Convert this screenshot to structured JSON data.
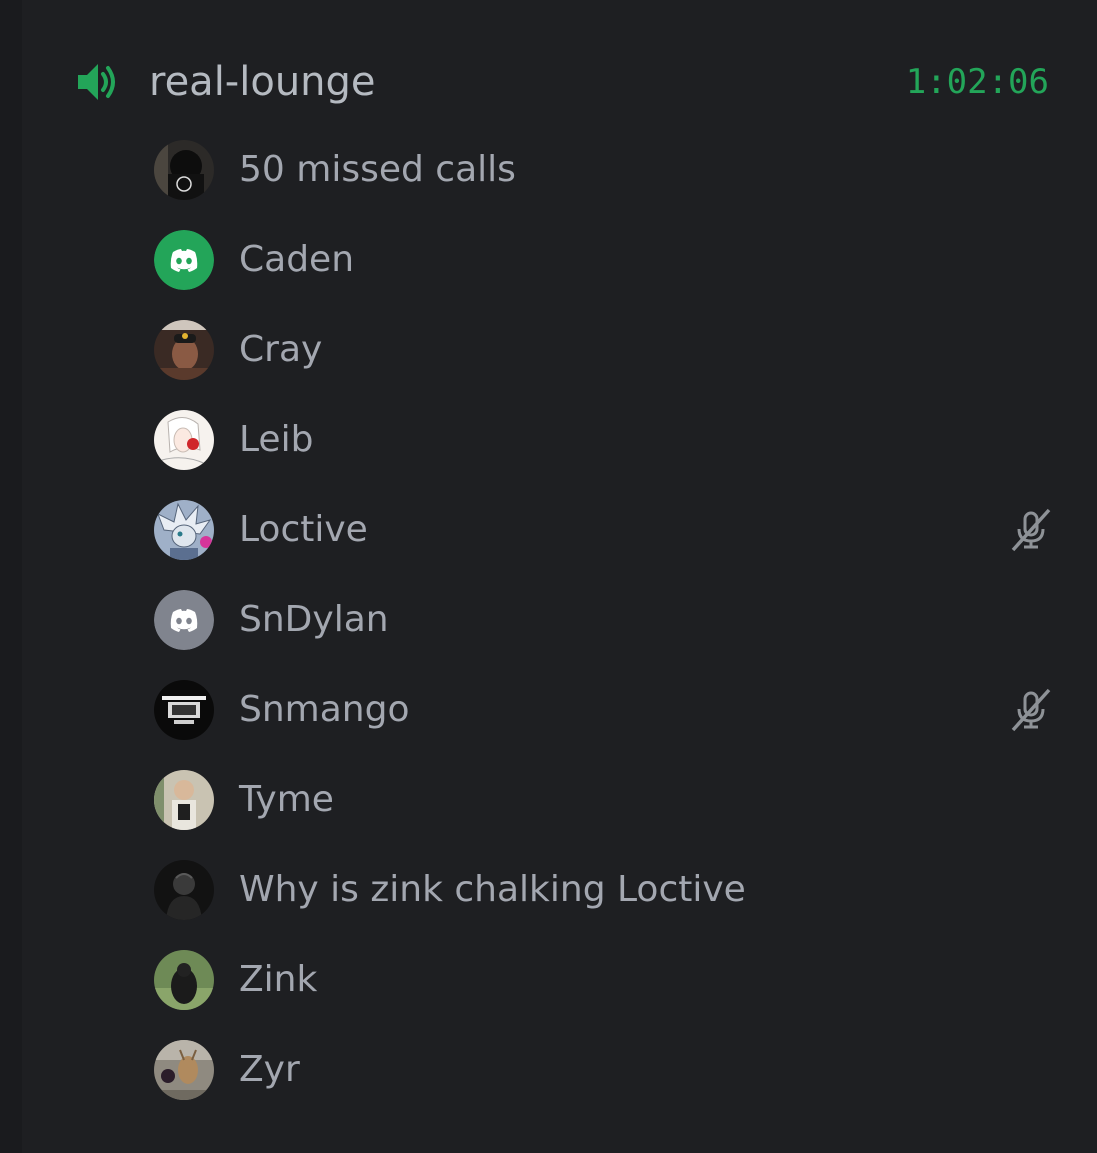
{
  "voice_channel": {
    "name": "real-lounge",
    "icon": "speaker-icon",
    "duration": "1:02:06",
    "accent_color": "#23a559"
  },
  "members": [
    {
      "name": "50 missed calls",
      "avatar": "photo-hooded-figure",
      "muted": false
    },
    {
      "name": "Caden",
      "avatar": "discord-logo-green",
      "muted": false
    },
    {
      "name": "Cray",
      "avatar": "photo-person-cap",
      "muted": false
    },
    {
      "name": "Leib",
      "avatar": "drawing-anime-girl",
      "muted": false
    },
    {
      "name": "Loctive",
      "avatar": "drawing-silver-hedgehog",
      "muted": true,
      "muted_icon": "microphone-muted-icon"
    },
    {
      "name": "SnDylan",
      "avatar": "discord-logo-gray",
      "muted": false
    },
    {
      "name": "Snmango",
      "avatar": "photo-dark-sign",
      "muted": true,
      "muted_icon": "microphone-muted-icon"
    },
    {
      "name": "Tyme",
      "avatar": "photo-mirror-selfie",
      "muted": false
    },
    {
      "name": "Why is zink chalking Loctive",
      "avatar": "photo-dark-figure",
      "muted": false
    },
    {
      "name": "Zink",
      "avatar": "photo-gorilla",
      "muted": false
    },
    {
      "name": "Zyr",
      "avatar": "photo-deer",
      "muted": false
    }
  ]
}
